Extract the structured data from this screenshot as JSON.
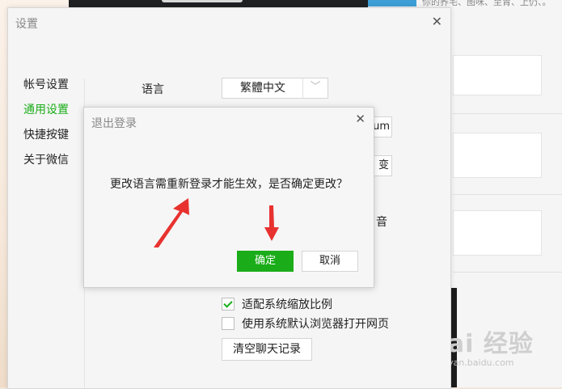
{
  "background": {
    "snippet": "你的荞宅、图咪、至胄、上仍、。",
    "watermark_main": "Bai 经验",
    "watermark_sub": "jingyan.baidu.com"
  },
  "settings": {
    "title": "设置",
    "close_icon": "close-icon",
    "sidebar": [
      {
        "label": "帐号设置",
        "active": false
      },
      {
        "label": "通用设置",
        "active": true
      },
      {
        "label": "快捷按键",
        "active": false
      },
      {
        "label": "关于微信",
        "active": false
      }
    ],
    "language_label": "语言",
    "language_value": "繁體中文",
    "partial_field_text": "um",
    "partial_button_text": "变",
    "partial_label_text": "音",
    "checkboxes": [
      {
        "label": "适配系统缩放比例",
        "checked": true
      },
      {
        "label": "使用系统默认浏览器打开网页",
        "checked": false
      }
    ],
    "clear_button": "清空聊天记录"
  },
  "dialog": {
    "title": "退出登录",
    "message": "更改语言需重新登录才能生效，是否确定更改？",
    "ok": "确定",
    "cancel": "取消"
  },
  "colors": {
    "accent": "#1aad19",
    "annotation": "#e8322f"
  }
}
